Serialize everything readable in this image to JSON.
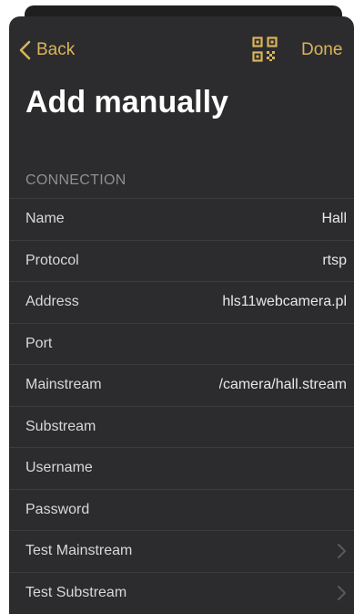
{
  "colors": {
    "accent": "#d9b45a",
    "sheet_background": "#2c2c2e",
    "separator": "#3d3d40",
    "section_header": "#8e8e93",
    "title": "#ffffff"
  },
  "navbar": {
    "back_label": "Back",
    "back_icon": "chevron-left-icon",
    "qr_icon": "qr-code-icon",
    "done_label": "Done"
  },
  "page": {
    "title": "Add manually"
  },
  "connection": {
    "section_title": "CONNECTION",
    "rows": [
      {
        "label": "Name",
        "value": "Hall"
      },
      {
        "label": "Protocol",
        "value": "rtsp"
      },
      {
        "label": "Address",
        "value": "hls11webcamera.pl"
      },
      {
        "label": "Port",
        "value": ""
      },
      {
        "label": "Mainstream",
        "value": "/camera/hall.stream"
      },
      {
        "label": "Substream",
        "value": ""
      },
      {
        "label": "Username",
        "value": ""
      },
      {
        "label": "Password",
        "value": ""
      },
      {
        "label": "Test Mainstream",
        "icon": "chevron-right-icon"
      },
      {
        "label": "Test Substream",
        "icon": "chevron-right-icon"
      }
    ]
  }
}
